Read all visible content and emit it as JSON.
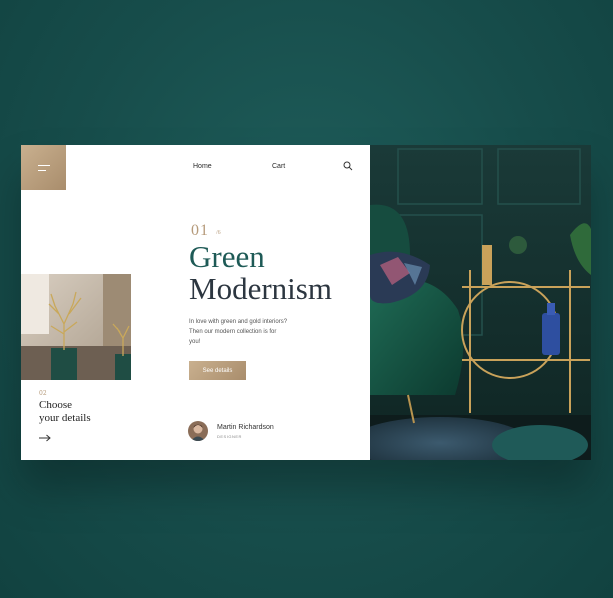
{
  "nav": {
    "home": "Home",
    "cart": "Cart"
  },
  "sidebar": {
    "step_no": "02",
    "step_title_line1": "Choose",
    "step_title_line2": "your details"
  },
  "hero": {
    "slide_no": "01",
    "slide_total": "/6",
    "title_line1": "Green",
    "title_line2": "Modernism",
    "description": "In love with green and gold interiors? Then our modern collection is for you!",
    "cta": "See details"
  },
  "author": {
    "name": "Martin Richardson",
    "role": "DESIGNER"
  },
  "colors": {
    "background": "#1a5553",
    "accent_gold": "#b59a7a",
    "title_green": "#1e5a56",
    "title_dark": "#2c3640"
  }
}
